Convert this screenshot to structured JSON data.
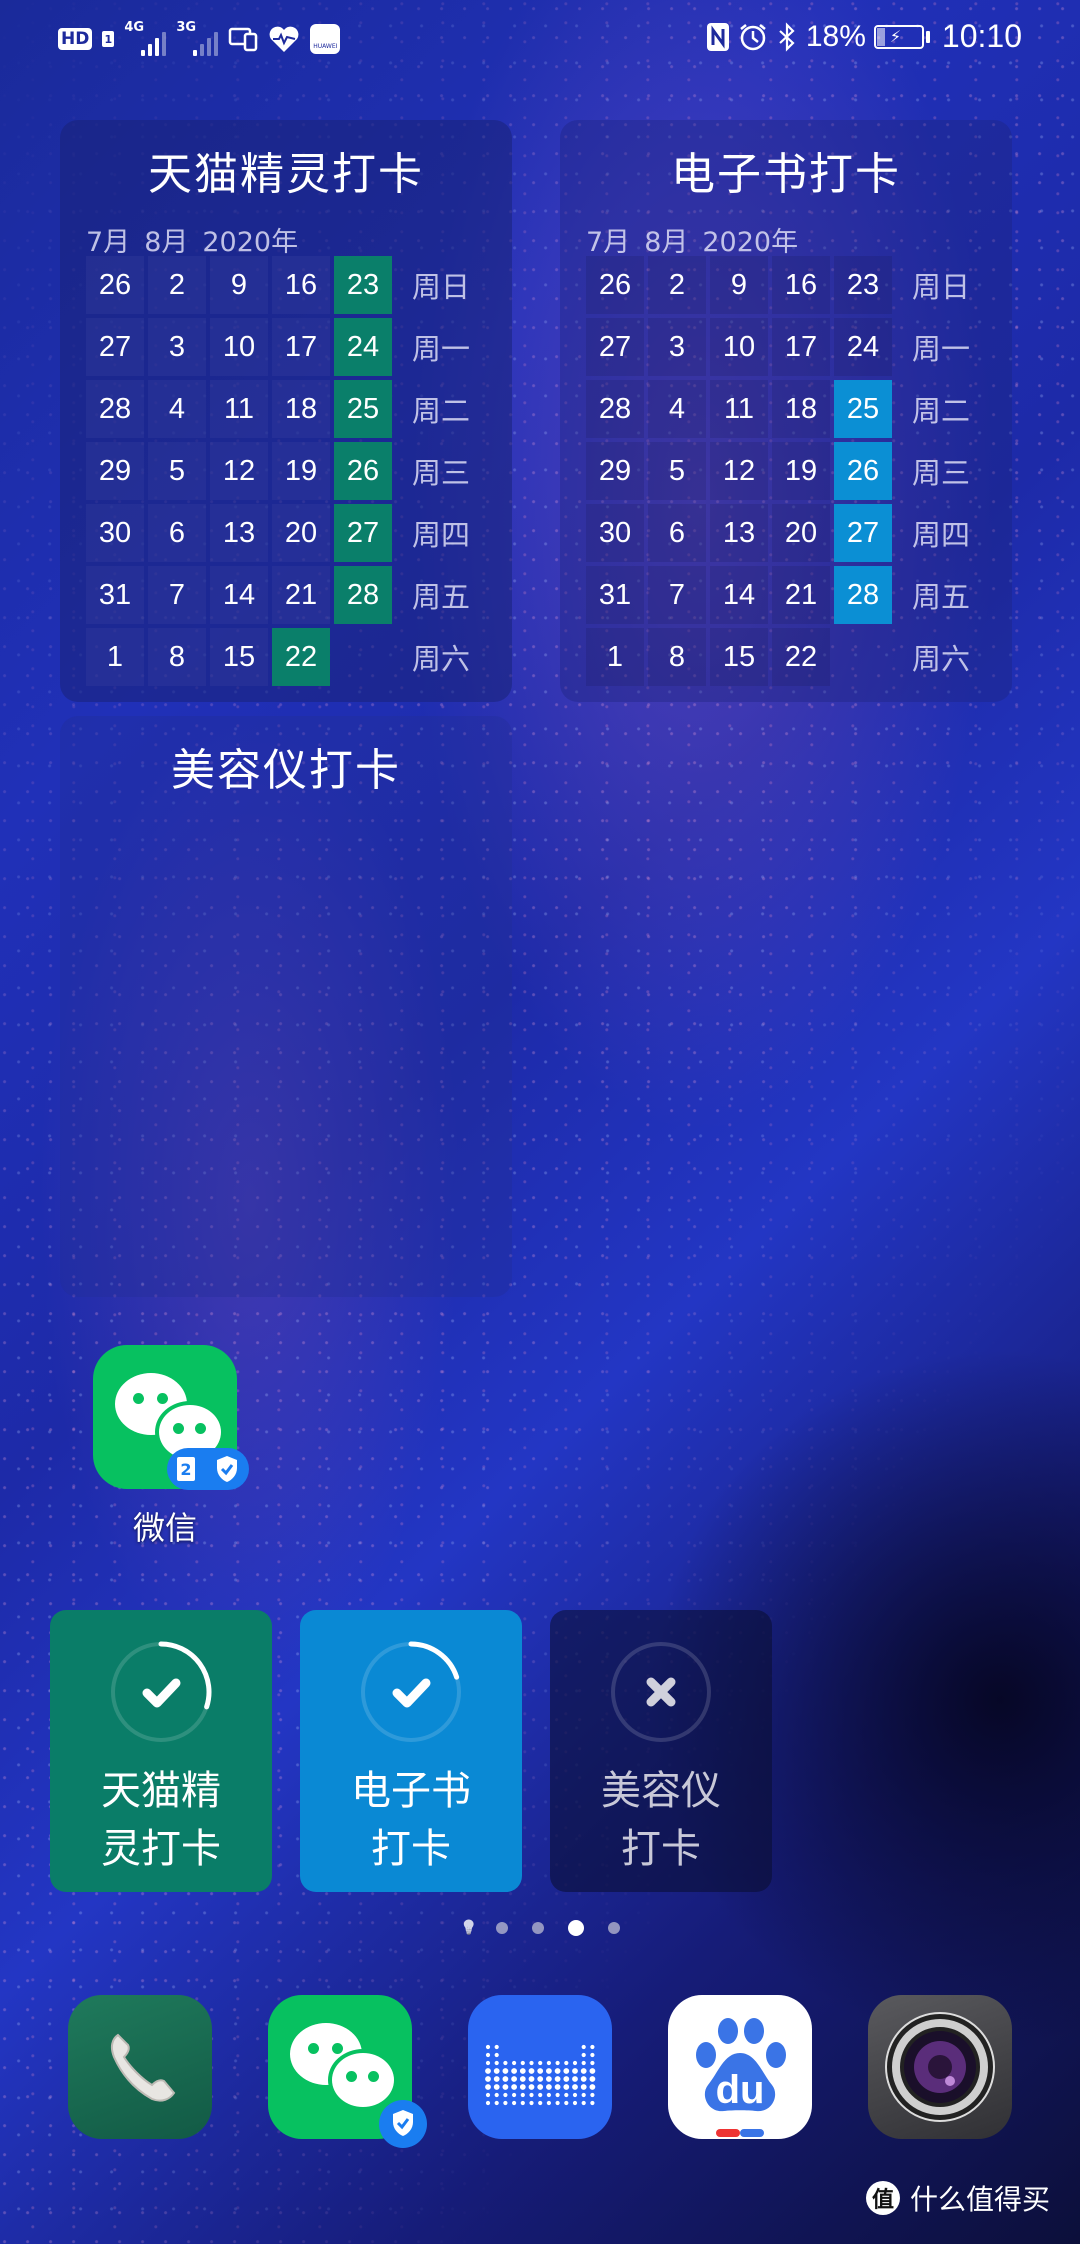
{
  "status_bar": {
    "left_icons": [
      "hd-volte-icon",
      "sim-1-icon",
      "signal-4g-icon",
      "signal-3g-icon",
      "multi-device-icon",
      "health-icon",
      "huawei-appgallery-icon"
    ],
    "hd_label": "HD",
    "sim_label": "1",
    "net1_label": "4G",
    "net2_label": "3G",
    "huawei_label": "HUAWEI",
    "right_icons": [
      "nfc-icon",
      "alarm-icon",
      "bluetooth-icon",
      "battery-charging-icon"
    ],
    "battery_percent_text": "18%",
    "battery_level": 0.18,
    "time": "10:10"
  },
  "calendar_widgets": [
    {
      "title": "天猫精灵打卡",
      "months": [
        "7月",
        "8月",
        "2020年"
      ],
      "highlight_color": "#0a7f6a",
      "rows": [
        {
          "dow": "周日",
          "days": [
            "26",
            "2",
            "9",
            "16",
            "23"
          ],
          "checked": [
            false,
            false,
            false,
            false,
            true
          ]
        },
        {
          "dow": "周一",
          "days": [
            "27",
            "3",
            "10",
            "17",
            "24"
          ],
          "checked": [
            false,
            false,
            false,
            false,
            true
          ]
        },
        {
          "dow": "周二",
          "days": [
            "28",
            "4",
            "11",
            "18",
            "25"
          ],
          "checked": [
            false,
            false,
            false,
            false,
            true
          ]
        },
        {
          "dow": "周三",
          "days": [
            "29",
            "5",
            "12",
            "19",
            "26"
          ],
          "checked": [
            false,
            false,
            false,
            false,
            true
          ]
        },
        {
          "dow": "周四",
          "days": [
            "30",
            "6",
            "13",
            "20",
            "27"
          ],
          "checked": [
            false,
            false,
            false,
            false,
            true
          ]
        },
        {
          "dow": "周五",
          "days": [
            "31",
            "7",
            "14",
            "21",
            "28"
          ],
          "checked": [
            false,
            false,
            false,
            false,
            true
          ]
        },
        {
          "dow": "周六",
          "days": [
            "1",
            "8",
            "15",
            "22",
            ""
          ],
          "checked": [
            false,
            false,
            false,
            true,
            false
          ]
        }
      ]
    },
    {
      "title": "电子书打卡",
      "months": [
        "7月",
        "8月",
        "2020年"
      ],
      "highlight_color": "#0b8fd4",
      "rows": [
        {
          "dow": "周日",
          "days": [
            "26",
            "2",
            "9",
            "16",
            "23"
          ],
          "checked": [
            false,
            false,
            false,
            false,
            false
          ]
        },
        {
          "dow": "周一",
          "days": [
            "27",
            "3",
            "10",
            "17",
            "24"
          ],
          "checked": [
            false,
            false,
            false,
            false,
            false
          ]
        },
        {
          "dow": "周二",
          "days": [
            "28",
            "4",
            "11",
            "18",
            "25"
          ],
          "checked": [
            false,
            false,
            false,
            false,
            true
          ]
        },
        {
          "dow": "周三",
          "days": [
            "29",
            "5",
            "12",
            "19",
            "26"
          ],
          "checked": [
            false,
            false,
            false,
            false,
            true
          ]
        },
        {
          "dow": "周四",
          "days": [
            "30",
            "6",
            "13",
            "20",
            "27"
          ],
          "checked": [
            false,
            false,
            false,
            false,
            true
          ]
        },
        {
          "dow": "周五",
          "days": [
            "31",
            "7",
            "14",
            "21",
            "28"
          ],
          "checked": [
            false,
            false,
            false,
            false,
            true
          ]
        },
        {
          "dow": "周六",
          "days": [
            "1",
            "8",
            "15",
            "22",
            ""
          ],
          "checked": [
            false,
            false,
            false,
            false,
            false
          ]
        }
      ]
    },
    {
      "title": "美容仪打卡"
    }
  ],
  "apps": {
    "wechat": {
      "label": "微信",
      "badge_twin": "2"
    }
  },
  "checkin_buttons": [
    {
      "line1": "天猫精",
      "line2": "灵打卡",
      "state": "done",
      "progress": 0.3,
      "color": "#0a7d68"
    },
    {
      "line1": "电子书",
      "line2": "打卡",
      "state": "done",
      "progress": 0.2,
      "color": "#0a89d4"
    },
    {
      "line1": "美容仪",
      "line2": "打卡",
      "state": "not-done",
      "progress": 0,
      "color": "#0a0c2d"
    }
  ],
  "page_indicator": {
    "total_pages": 4,
    "active_index": 2,
    "has_hint_page": true
  },
  "dock": [
    {
      "name": "phone",
      "icon": "phone-icon"
    },
    {
      "name": "wechat",
      "icon": "wechat-icon"
    },
    {
      "name": "tmall-genie",
      "icon": "tmall-genie-icon"
    },
    {
      "name": "baidu",
      "icon": "baidu-icon",
      "text": "du"
    },
    {
      "name": "camera",
      "icon": "camera-icon"
    }
  ],
  "watermark": {
    "logo": "值",
    "text": "什么值得买"
  }
}
